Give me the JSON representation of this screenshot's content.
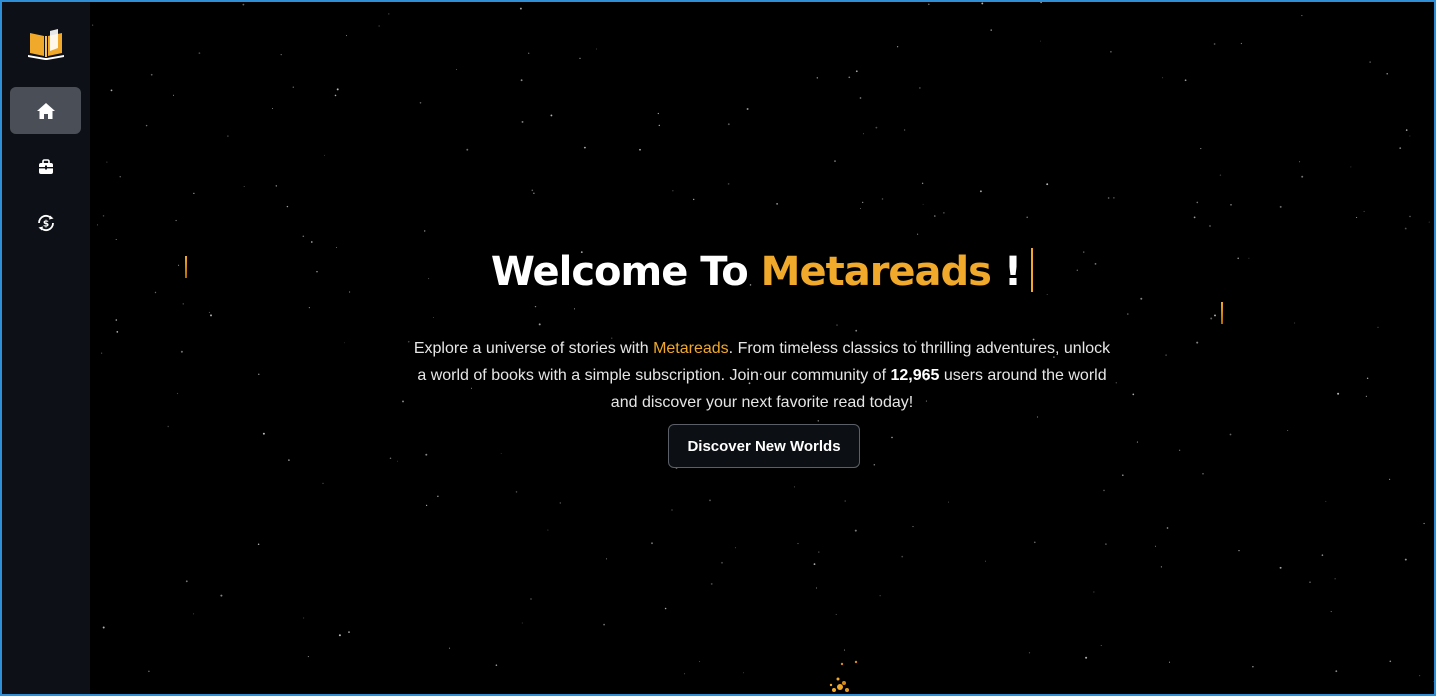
{
  "sidebar": {
    "logo_icon": "open-book-icon",
    "items": [
      {
        "name": "home",
        "icon": "home-icon",
        "active": true
      },
      {
        "name": "store",
        "icon": "shopping-bag-icon",
        "active": false
      },
      {
        "name": "subscription",
        "icon": "dollar-refresh-icon",
        "active": false
      }
    ]
  },
  "hero": {
    "title_prefix": "Welcome To ",
    "title_brand": "Metareads",
    "title_suffix": " !",
    "desc_part1": "Explore a universe of stories with ",
    "desc_brand": "Metareads",
    "desc_part2": ". From timeless classics to thrilling adventures, unlock a world of books with a simple subscription. Join our community of ",
    "desc_count": "12,965",
    "desc_part3": " users around the world and discover your next favorite read today!",
    "cta_label": "Discover New Worlds"
  },
  "colors": {
    "accent": "#f0a92a",
    "background": "#000000",
    "sidebar": "#0d1117",
    "active_nav": "#4a4f57"
  }
}
